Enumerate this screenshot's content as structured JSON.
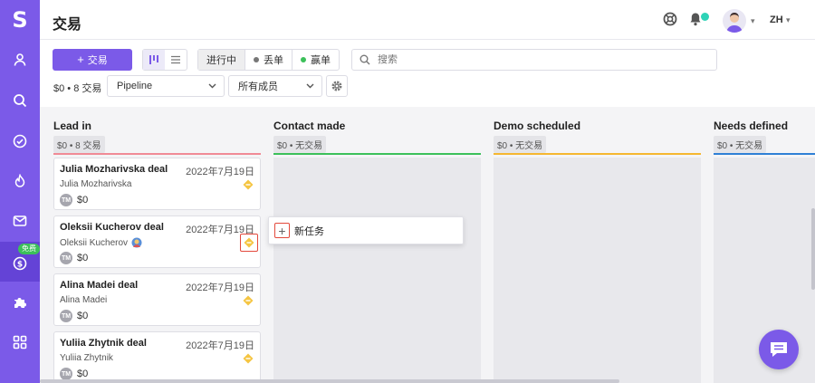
{
  "app": {
    "logo_letter": "S",
    "title": "交易",
    "free_badge": "免费"
  },
  "colors": {
    "accent": "#7b5ae8",
    "lead_in": "#f08a96",
    "contact_made": "#3cc05a",
    "demo_scheduled": "#f5b731",
    "needs_defined": "#2f80d6",
    "highlight": "#e3493c"
  },
  "sidebar": {
    "items": [
      {
        "name": "contacts",
        "icon": "person-icon"
      },
      {
        "name": "search",
        "icon": "search-icon"
      },
      {
        "name": "tasks",
        "icon": "check-circle-icon"
      },
      {
        "name": "activity",
        "icon": "flame-icon"
      },
      {
        "name": "inbox",
        "icon": "mail-icon"
      },
      {
        "name": "deals",
        "icon": "dollar-icon",
        "active": true
      },
      {
        "name": "integrations",
        "icon": "puzzle-icon"
      },
      {
        "name": "apps",
        "icon": "grid-icon"
      }
    ]
  },
  "topbar": {
    "language": "ZH"
  },
  "toolbar": {
    "add_deal_label": "交易",
    "status_filters": [
      {
        "label": "进行中",
        "active": true
      },
      {
        "label": "丢单",
        "dot_color": "#777777"
      },
      {
        "label": "赢单",
        "dot_color": "#3cc05a"
      }
    ],
    "search_placeholder": "搜索",
    "summary": "$0 • 8 交易",
    "pipeline_select": "Pipeline",
    "members_select": "所有成员"
  },
  "columns": [
    {
      "title": "Lead in",
      "meta": "$0 • 8 交易"
    },
    {
      "title": "Contact made",
      "meta": "$0 • 无交易"
    },
    {
      "title": "Demo scheduled",
      "meta": "$0 • 无交易"
    },
    {
      "title": "Needs defined",
      "meta": "$0 • 无交易"
    }
  ],
  "deals": [
    {
      "title": "Julia Mozharivska deal",
      "date": "2022年7月19日",
      "contact": "Julia Mozharivska",
      "owner_initials": "TM",
      "amount": "$0"
    },
    {
      "title": "Oleksii Kucherov deal",
      "date": "2022年7月19日",
      "contact": "Oleksii Kucherov",
      "owner_initials": "TM",
      "amount": "$0",
      "highlighted": true
    },
    {
      "title": "Alina Madei deal",
      "date": "2022年7月19日",
      "contact": "Alina Madei",
      "owner_initials": "TM",
      "amount": "$0"
    },
    {
      "title": "Yuliia Zhytnik deal",
      "date": "2022年7月19日",
      "contact": "Yuliia Zhytnik",
      "owner_initials": "TM",
      "amount": "$0"
    }
  ],
  "popup": {
    "new_task_label": "新任务"
  }
}
